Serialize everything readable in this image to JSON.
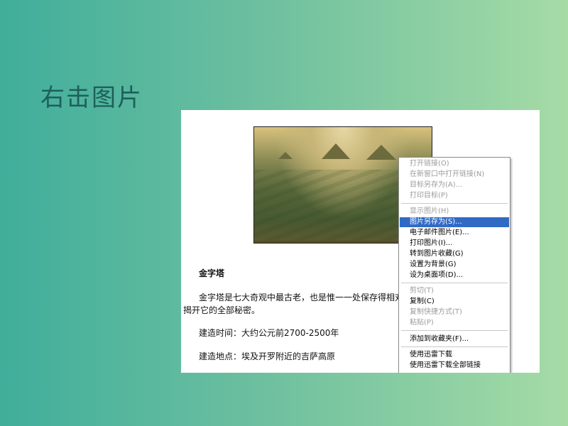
{
  "slide": {
    "title": "右击图片"
  },
  "page": {
    "article_heading": "金字塔",
    "paragraph_line1": "金字塔是七大奇观中最古老，也是惟一一处保存得相对",
    "paragraph_line2": "揭开它的全部秘密。",
    "build_time": "建造时间：大约公元前2700-2500年",
    "build_location": "建造地点：埃及开罗附近的吉萨高原"
  },
  "context_menu": {
    "items": [
      {
        "label": "打开链接(O)",
        "enabled": false
      },
      {
        "label": "在新窗口中打开链接(N)",
        "enabled": false
      },
      {
        "label": "目标另存为(A)...",
        "enabled": false
      },
      {
        "label": "打印目标(P)",
        "enabled": false
      },
      {
        "label": "显示图片(H)",
        "enabled": false
      },
      {
        "label": "图片另存为(S)...",
        "enabled": true,
        "highlighted": true
      },
      {
        "label": "电子邮件图片(E)...",
        "enabled": true
      },
      {
        "label": "打印图片(I)...",
        "enabled": true
      },
      {
        "label": "转到图片收藏(G)",
        "enabled": true
      },
      {
        "label": "设置为背景(G)",
        "enabled": true
      },
      {
        "label": "设为桌面项(D)...",
        "enabled": true
      },
      {
        "label": "剪切(T)",
        "enabled": false
      },
      {
        "label": "复制(C)",
        "enabled": true
      },
      {
        "label": "复制快捷方式(T)",
        "enabled": false
      },
      {
        "label": "粘贴(P)",
        "enabled": false
      },
      {
        "label": "添加到收藏夹(F)...",
        "enabled": true
      },
      {
        "label": "使用迅雷下载",
        "enabled": true
      },
      {
        "label": "使用迅雷下载全部链接",
        "enabled": true
      }
    ]
  },
  "colors": {
    "title": "#1d5f5b",
    "menu_highlight": "#316ac5",
    "menu_disabled": "#9c9c9c"
  }
}
